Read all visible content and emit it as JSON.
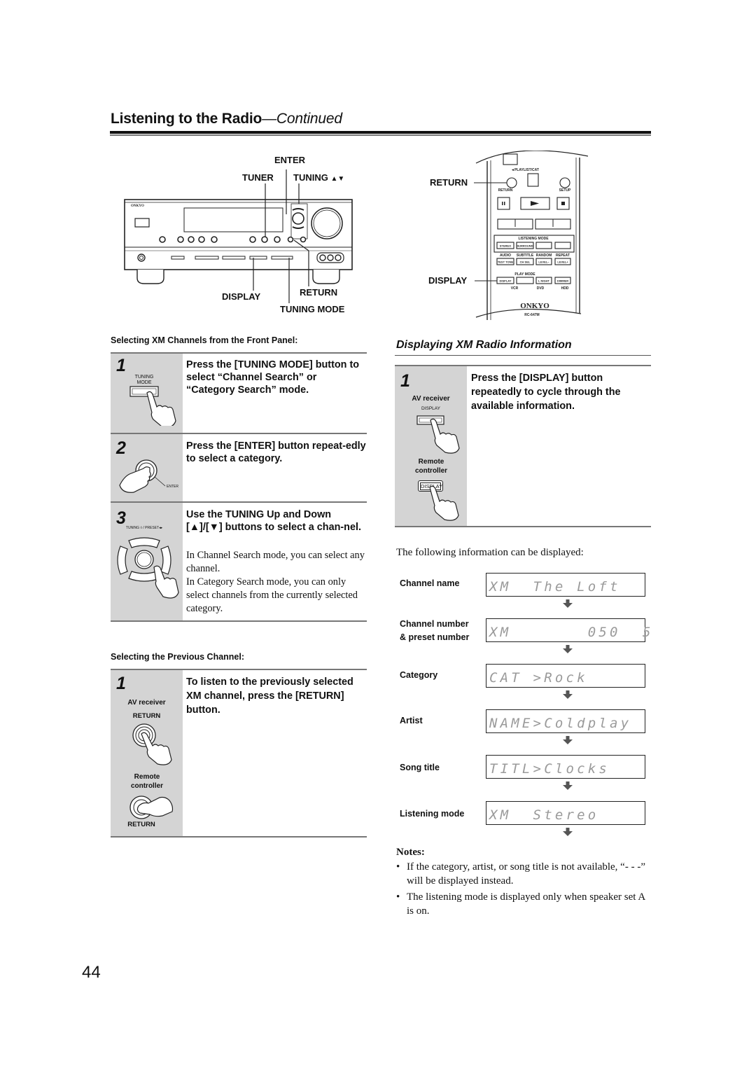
{
  "header": {
    "title": "Listening to the Radio",
    "continued": "—Continued"
  },
  "receiver_diagram": {
    "brand": "ONKYO",
    "callouts": {
      "enter": "ENTER",
      "tuner": "TUNER",
      "tuning": "TUNING",
      "display": "DISPLAY",
      "return": "RETURN",
      "tuning_mode": "TUNING MODE"
    }
  },
  "remote_diagram": {
    "brand": "ONKYO",
    "model": "RC-647M",
    "callouts": {
      "return": "RETURN",
      "display": "DISPLAY"
    },
    "button_labels": {
      "playlist_cat": "◄PLAYLIST/CAT",
      "return": "RETURN",
      "setup": "SETUP",
      "listening_mode": "LISTENING MODE",
      "stereo": "STEREO",
      "surround": "SURROUND",
      "audio": "AUDIO",
      "subtitle": "SUBTITLE",
      "random": "RANDOM",
      "repeat": "REPEAT",
      "test_tone": "TEST TONE",
      "ch_sel": "CH SEL",
      "level_minus": "LEVEL−",
      "level_plus": "LEVEL+",
      "play_mode": "PLAY MODE",
      "display": "DISPLAY",
      "l_night": "L NIGHT",
      "dimmer": "DIMMER",
      "vcr": "VCR",
      "dvd": "DVD",
      "hdd": "HDD"
    }
  },
  "front_panel_section": {
    "subhead": "Selecting XM Channels from the Front Panel:",
    "steps": [
      {
        "number": "1",
        "icon_label": "TUNING\nMODE",
        "heading": "Press the [TUNING MODE] button to select “Channel Search” or “Category Search” mode.",
        "body": []
      },
      {
        "number": "2",
        "icon_label": "ENTER",
        "heading": "Press the [ENTER] button repeat-edly to select a category.",
        "body": []
      },
      {
        "number": "3",
        "icon_label": "TUNING ◊ / PRESET◂▸",
        "heading": "Use the TUNING Up and Down [▲]/[▼] buttons to select a chan-nel.",
        "body": [
          "In Channel Search mode, you can select any channel.",
          "In Category Search mode, you can only select channels from the currently selected category."
        ]
      }
    ]
  },
  "previous_channel_section": {
    "subhead": "Selecting the Previous Channel:",
    "step": {
      "number": "1",
      "av_receiver_label": "AV receiver",
      "receiver_button_label": "RETURN",
      "remote_label": "Remote controller",
      "remote_button_label": "RETURN",
      "heading": "To listen to the previously selected XM channel, press the [RETURN] button."
    }
  },
  "display_info_section": {
    "title": "Displaying XM Radio Information",
    "step": {
      "number": "1",
      "av_receiver_label": "AV receiver",
      "receiver_button_label": "DISPLAY",
      "remote_label": "Remote controller",
      "remote_button_label": "DISPLAY",
      "heading": "Press the [DISPLAY] button repeatedly to cycle through the available information."
    },
    "intro": "The following information can be displayed:",
    "displays": [
      {
        "label": "Channel name",
        "lcd": "XM  The Loft"
      },
      {
        "label": "Channel number\n& preset number",
        "lcd": "XM       050  5"
      },
      {
        "label": "Category",
        "lcd": "CAT >Rock"
      },
      {
        "label": "Artist",
        "lcd": "NAME>Coldplay"
      },
      {
        "label": "Song title",
        "lcd": "TITL>Clocks"
      },
      {
        "label": "Listening mode",
        "lcd": "XM  Stereo"
      }
    ]
  },
  "notes": {
    "title": "Notes:",
    "items": [
      "If the category, artist, or song title is not available, “- - -” will be displayed instead.",
      "The listening mode is displayed only when speaker set A is on."
    ]
  },
  "page_number": "44"
}
